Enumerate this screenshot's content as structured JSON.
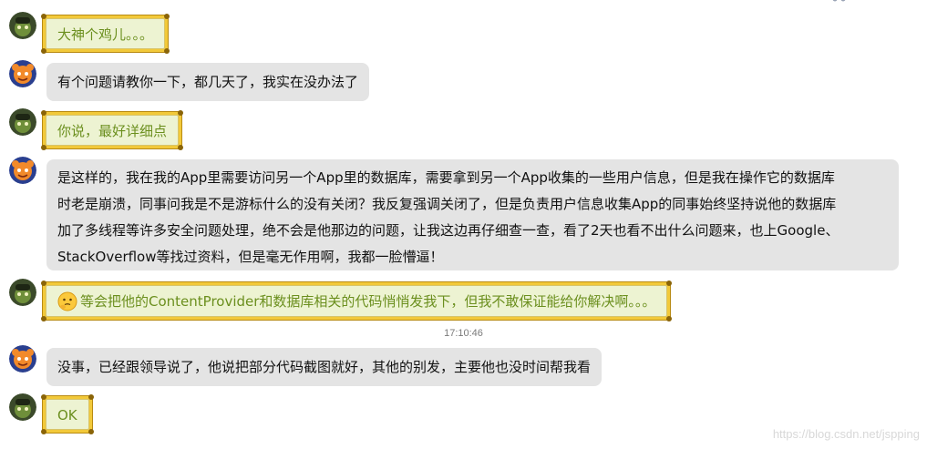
{
  "messages": [
    {
      "sender": "self",
      "text": "大神个鸡儿。。。"
    },
    {
      "sender": "other",
      "text": "有个问题请教你一下，都几天了，我实在没办法了"
    },
    {
      "sender": "self",
      "text": "你说，最好详细点"
    },
    {
      "sender": "other",
      "lines": [
        "是这样的，我在我的App里需要访问另一个App里的数据库，需要拿到另一个App收集的一些用户信息，但是我在操作它的数据库",
        "时老是崩溃，同事问我是不是游标什么的没有关闭？我反复强调关闭了，但是负责用户信息收集App的同事始终坚持说他的数据库",
        "加了多线程等许多安全问题处理，绝不会是他那边的问题，让我这边再仔细查一查，看了2天也看不出什么问题来，也上Google、",
        "StackOverflow等找过资料，但是毫无作用啊，我都一脸懵逼！"
      ]
    },
    {
      "sender": "self",
      "emoji": "thinking-face-icon",
      "text": "等会把他的ContentProvider和数据库相关的代码悄悄发我下，但我不敢保证能给你解决啊。。。"
    },
    {
      "sender": "other",
      "text": "没事，已经跟领导说了，他说把部分代码截图就好，其他的别发，主要他也没时间帮我看"
    },
    {
      "sender": "self",
      "text": "OK"
    }
  ],
  "timestamp": "17:10:46",
  "watermark": "https://blog.csdn.net/jspping",
  "colors": {
    "self_text": "#6b8f1e",
    "self_bg": "#edf3d2",
    "frame": "#f2c93a",
    "other_bg": "#e4e4e4"
  }
}
